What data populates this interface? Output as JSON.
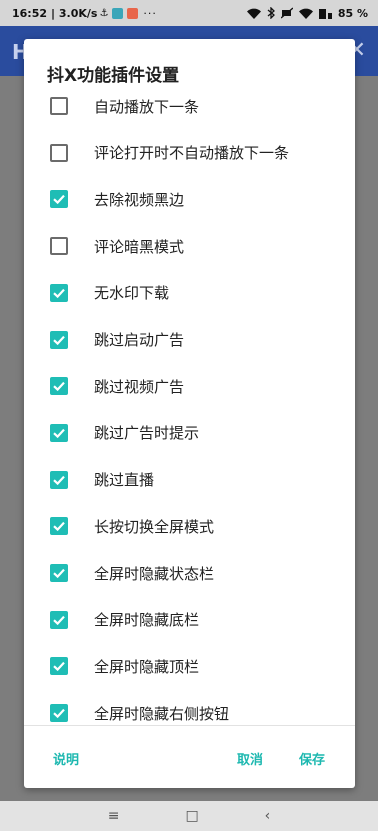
{
  "status_bar": {
    "time": "16:52",
    "speed": "| 3.0K/s",
    "battery": "85 %",
    "icons": [
      "notification-icon",
      "app-icon-a",
      "app-icon-b",
      "more-icon",
      "wifi-icon",
      "bluetooth-icon",
      "mute-icon",
      "signal-icon",
      "battery-icon"
    ]
  },
  "background_app": {
    "title_initial": "H",
    "close_glyph": "✕"
  },
  "dialog": {
    "title": "抖X功能插件设置",
    "options": [
      {
        "label": "自动播放下一条",
        "checked": false
      },
      {
        "label": "评论打开时不自动播放下一条",
        "checked": false
      },
      {
        "label": "去除视频黑边",
        "checked": true
      },
      {
        "label": "评论暗黑模式",
        "checked": false
      },
      {
        "label": "无水印下载",
        "checked": true
      },
      {
        "label": "跳过启动广告",
        "checked": true
      },
      {
        "label": "跳过视频广告",
        "checked": true
      },
      {
        "label": "跳过广告时提示",
        "checked": true
      },
      {
        "label": "跳过直播",
        "checked": true
      },
      {
        "label": "长按切换全屏模式",
        "checked": true
      },
      {
        "label": "全屏时隐藏状态栏",
        "checked": true
      },
      {
        "label": "全屏时隐藏底栏",
        "checked": true
      },
      {
        "label": "全屏时隐藏顶栏",
        "checked": true
      },
      {
        "label": "全屏时隐藏右侧按钮",
        "checked": true
      }
    ],
    "buttons": {
      "explain": "说明",
      "cancel": "取消",
      "save": "保存"
    }
  },
  "nav_bar": {
    "menu": "≡",
    "home": "□",
    "back": "‹"
  },
  "colors": {
    "accent": "#1fbdb5",
    "app_bar": "#2a4c9e",
    "scrim": "#7d7d7d"
  }
}
